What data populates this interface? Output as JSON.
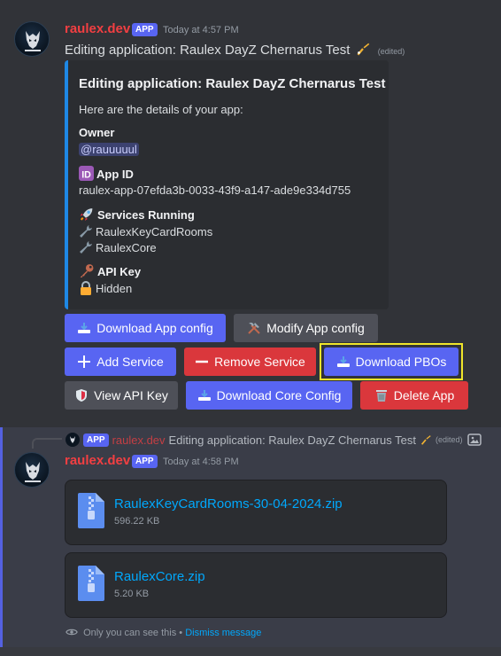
{
  "message1": {
    "username": "raulex.dev",
    "badge": "APP",
    "timestamp": "Today at 4:57 PM",
    "content": "Editing application: Raulex DayZ Chernarus Test",
    "edited": "(edited)",
    "embed": {
      "color": "#1e88e5",
      "title": "Editing application: Raulex DayZ Chernarus Test",
      "description": "Here are the details of your app:",
      "fields": [
        {
          "name": "Owner",
          "values": [
            "@rauuuuul"
          ]
        },
        {
          "name": "App ID",
          "values": [
            "raulex-app-07efda3b-0033-43f9-a147-ade9e334d755"
          ]
        },
        {
          "name": "Services Running",
          "values": [
            "RaulexKeyCardRooms",
            "RaulexCore"
          ]
        },
        {
          "name": "API Key",
          "values": [
            "Hidden"
          ]
        }
      ],
      "field_icons": [
        "id-badge-icon",
        "rocket-icon",
        "wrench-icon",
        "key-icon",
        "lock-icon"
      ]
    },
    "buttons": {
      "row1": [
        {
          "label": "Download App config",
          "style": "blurple",
          "icon": "tray-download-icon"
        },
        {
          "label": "Modify App config",
          "style": "grey",
          "icon": "hammer-pick-icon"
        }
      ],
      "row2": [
        {
          "label": "Add Service",
          "style": "blurple",
          "icon": "plus-icon"
        },
        {
          "label": "Remove Service",
          "style": "red",
          "icon": "minus-icon"
        },
        {
          "label": "Download PBOs",
          "style": "blurple",
          "icon": "tray-download-icon"
        }
      ],
      "row3": [
        {
          "label": "View API Key",
          "style": "grey",
          "icon": "shield-icon"
        },
        {
          "label": "Download Core Config",
          "style": "blurple",
          "icon": "tray-download-icon"
        },
        {
          "label": "Delete App",
          "style": "red",
          "icon": "trash-icon"
        }
      ]
    }
  },
  "message2": {
    "reply": {
      "badge": "APP",
      "username": "raulex.dev",
      "content": "Editing application: Raulex DayZ Chernarus Test",
      "edited": "(edited)"
    },
    "username": "raulex.dev",
    "badge": "APP",
    "timestamp": "Today at 4:58 PM",
    "attachments": [
      {
        "filename": "RaulexKeyCardRooms-30-04-2024.zip",
        "size": "596.22 KB"
      },
      {
        "filename": "RaulexCore.zip",
        "size": "5.20 KB"
      }
    ],
    "ephemeral": {
      "text": "Only you can see this",
      "separator": "•",
      "dismiss": "Dismiss message"
    }
  },
  "colors": {
    "background": "#313338",
    "blurple": "#5865f2",
    "red": "#da373c",
    "grey": "#4e5058",
    "link": "#00a8fc",
    "username": "#f23f42",
    "highlight": "#f0e52a"
  }
}
